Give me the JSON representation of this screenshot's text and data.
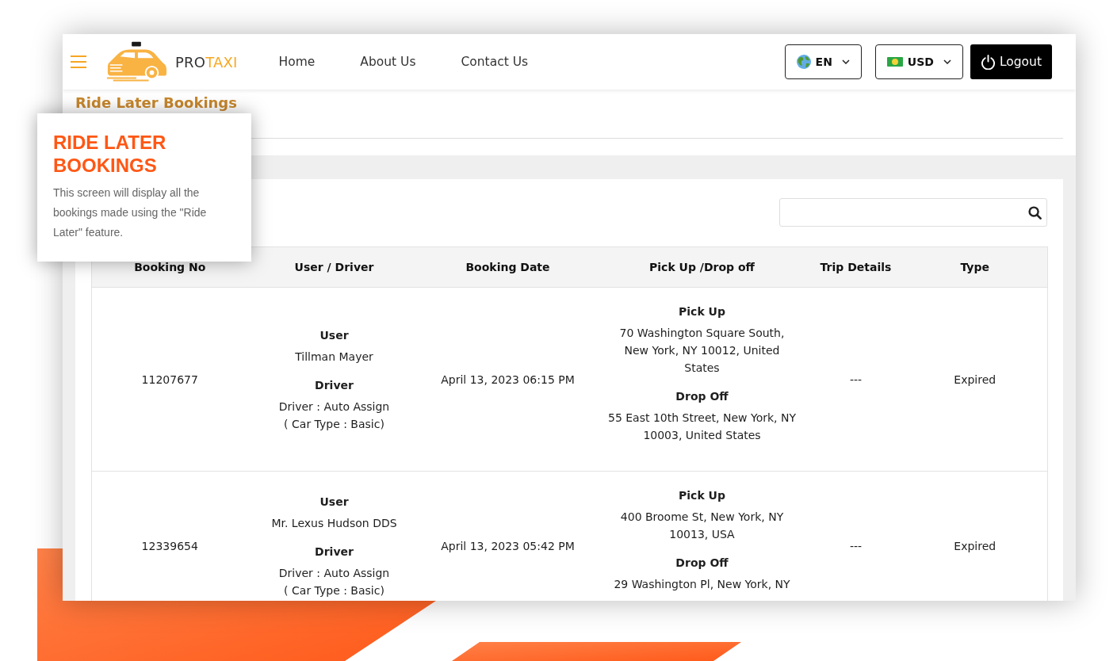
{
  "window": {
    "brand": {
      "prefix": "PRO",
      "suffix": "TAXI"
    },
    "nav": [
      {
        "label": "Home"
      },
      {
        "label": "About Us"
      },
      {
        "label": "Contact Us"
      }
    ],
    "language_select": {
      "value": "EN"
    },
    "currency_select": {
      "value": "USD"
    },
    "logout_button": {
      "label": "Logout"
    },
    "page_title": "Ride Later Bookings",
    "table": {
      "columns": [
        "Booking No",
        "User / Driver",
        "Booking Date",
        "Pick Up /Drop off",
        "Trip Details",
        "Type"
      ],
      "rows": [
        {
          "booking_no": "11207677",
          "user_label": "User",
          "user": "Tillman Mayer",
          "driver_label": "Driver",
          "driver": "Driver : Auto Assign",
          "car_type": "( Car Type : Basic)",
          "booking_date": "April 13, 2023 06:15 PM",
          "pickup_label": "Pick Up",
          "pickup": "70 Washington Square South, New York, NY 10012, United States",
          "dropoff_label": "Drop Off",
          "dropoff": "55 East 10th Street, New York, NY 10003, United States",
          "trip_details": "---",
          "type": "Expired"
        },
        {
          "booking_no": "12339654",
          "user_label": "User",
          "user": "Mr. Lexus Hudson DDS",
          "driver_label": "Driver",
          "driver": "Driver : Auto Assign",
          "car_type": "( Car Type : Basic)",
          "booking_date": "April 13, 2023 05:42 PM",
          "pickup_label": "Pick Up",
          "pickup": "400 Broome St, New York, NY 10013, USA",
          "dropoff_label": "Drop Off",
          "dropoff": "29 Washington Pl, New York, NY",
          "trip_details": "---",
          "type": "Expired"
        }
      ]
    }
  },
  "callout": {
    "title": "RIDE LATER BOOKINGS",
    "text": "This screen will display all the bookings made using the \"Ride Later\" feature."
  }
}
